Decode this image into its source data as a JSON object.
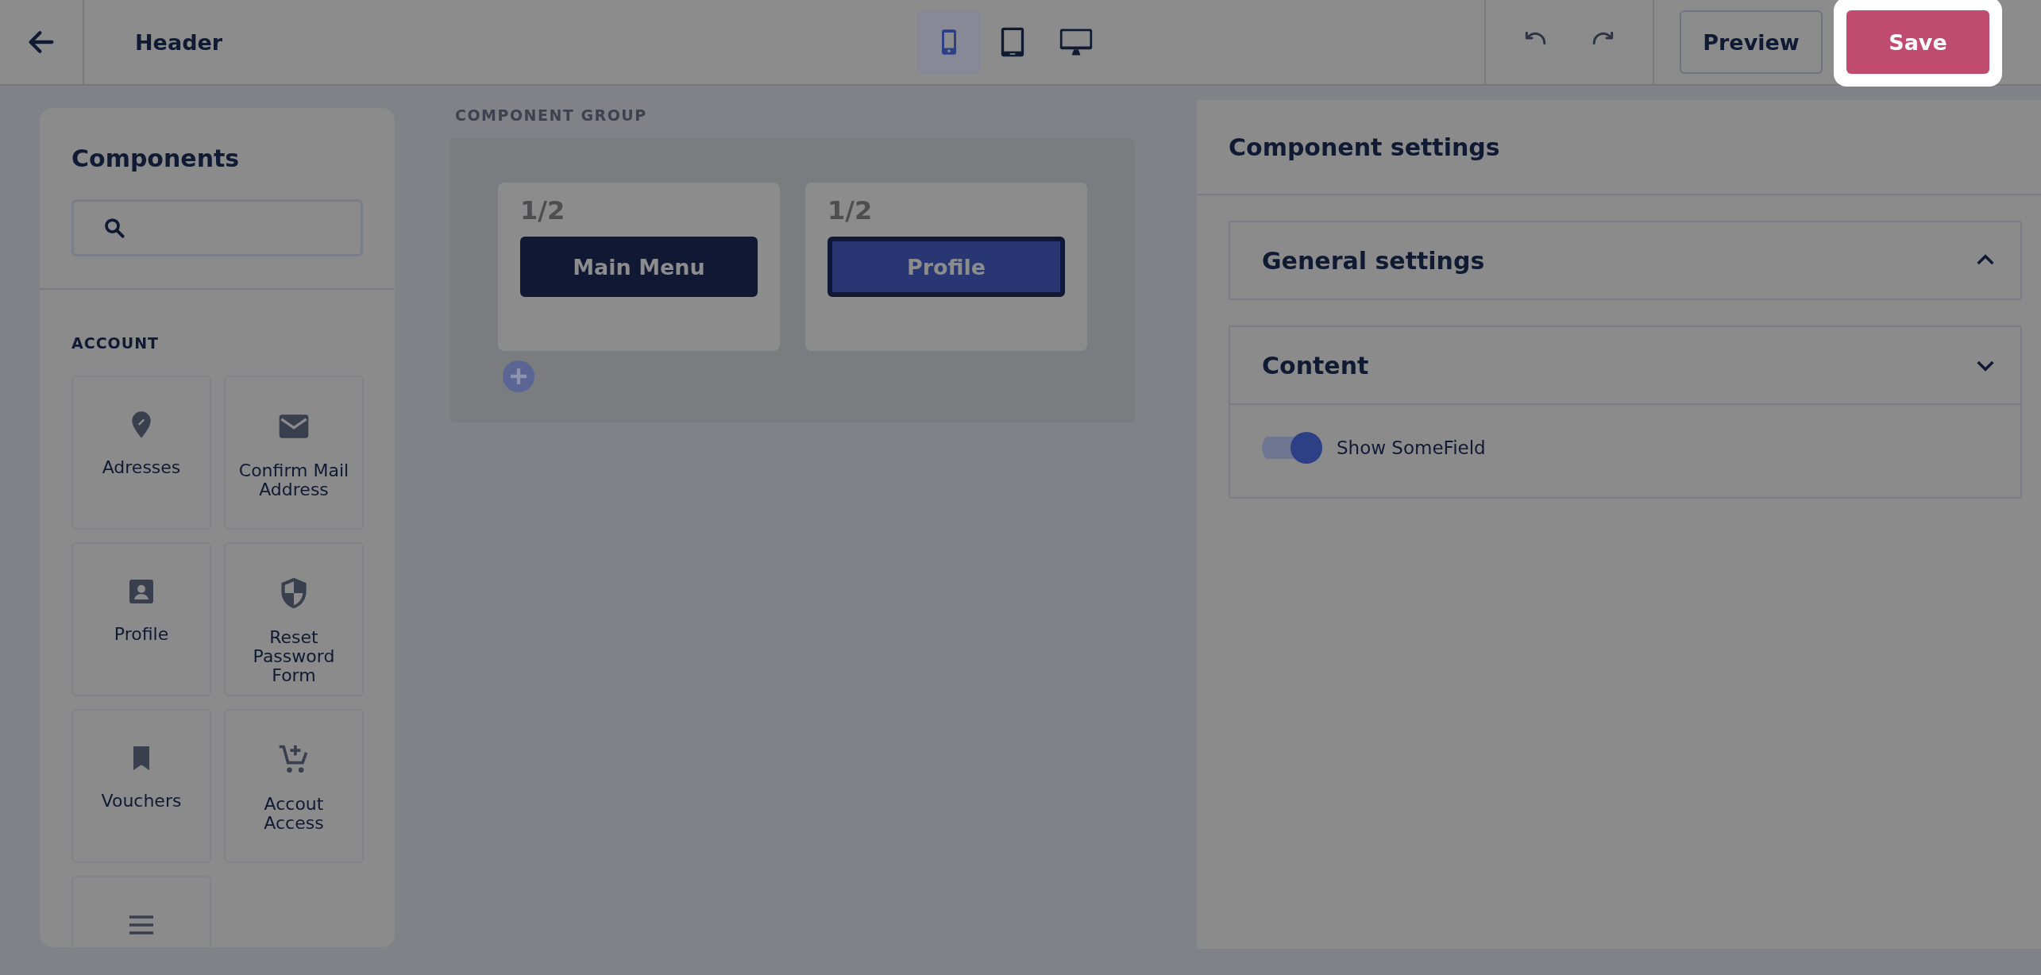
{
  "topbar": {
    "title": "Header",
    "devices": [
      {
        "selected": true
      },
      {
        "selected": false
      },
      {
        "selected": false
      }
    ],
    "preview": "Preview",
    "save": "Save"
  },
  "components": {
    "title": "Components",
    "section": "ACCOUNT",
    "items": [
      {
        "label": "Adresses"
      },
      {
        "label": "Confirm Mail Address"
      },
      {
        "label": "Profile"
      },
      {
        "label": "Reset Password Form"
      },
      {
        "label": "Vouchers"
      },
      {
        "label": "Accout Access"
      }
    ]
  },
  "group": {
    "label": "COMPONENT GROUP",
    "columns": [
      {
        "width": "1/2",
        "component": "Main Menu",
        "selected": false
      },
      {
        "width": "1/2",
        "component": "Profile",
        "selected": true
      }
    ]
  },
  "settings": {
    "title": "Component settings",
    "sections": [
      {
        "title": "General settings",
        "expanded": false
      },
      {
        "title": "Content",
        "expanded": true,
        "toggles": [
          {
            "label": "Show SomeField",
            "on": true
          }
        ]
      }
    ]
  }
}
